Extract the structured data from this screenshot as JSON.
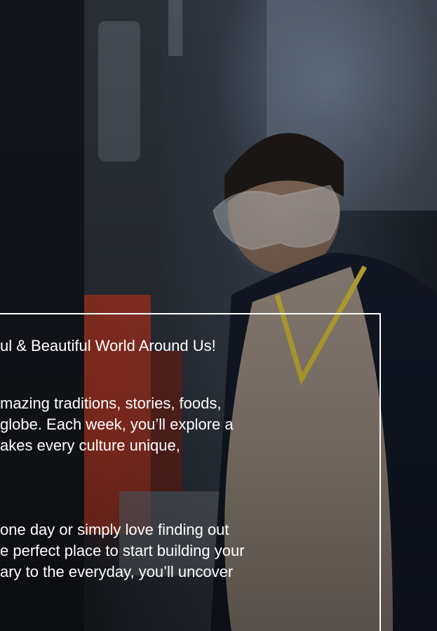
{
  "hero": {
    "image_alt": "Student wearing safety goggles and apron using a workshop machine",
    "colors": {
      "overlay": "#000000",
      "card_border": "#ffffff",
      "text": "#ffffff",
      "machine_red": "#b33a26"
    }
  },
  "card": {
    "heading": "ul & Beautiful World Around Us!",
    "paragraph1": [
      "mazing traditions, stories, foods,",
      " globe. Each week, you’ll explore a",
      "akes every culture unique,"
    ],
    "paragraph2": [
      "one day or simply love finding out",
      "e perfect place to start building your",
      "ary to the everyday, you’ll uncover"
    ]
  }
}
